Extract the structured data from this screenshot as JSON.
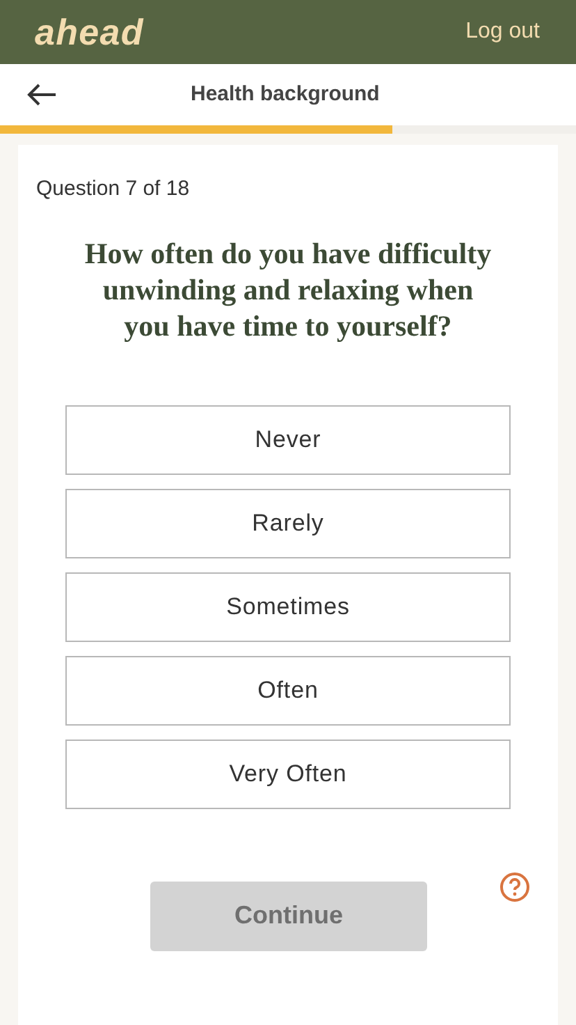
{
  "header": {
    "logo": "ahead",
    "logout": "Log out"
  },
  "nav": {
    "title": "Health background",
    "progress": {
      "level": 0.68
    }
  },
  "question": {
    "counter": "Question 7 of 18",
    "text": "How often do you have difficulty unwinding and relaxing when you have time to yourself?",
    "options": [
      {
        "label": "Never",
        "selected": false
      },
      {
        "label": "Rarely",
        "selected": false
      },
      {
        "label": "Sometimes",
        "selected": false
      },
      {
        "label": "Often",
        "selected": false
      },
      {
        "label": "Very Often",
        "selected": false
      }
    ]
  },
  "continue_button": {
    "label": "Continue",
    "disabled": true
  }
}
